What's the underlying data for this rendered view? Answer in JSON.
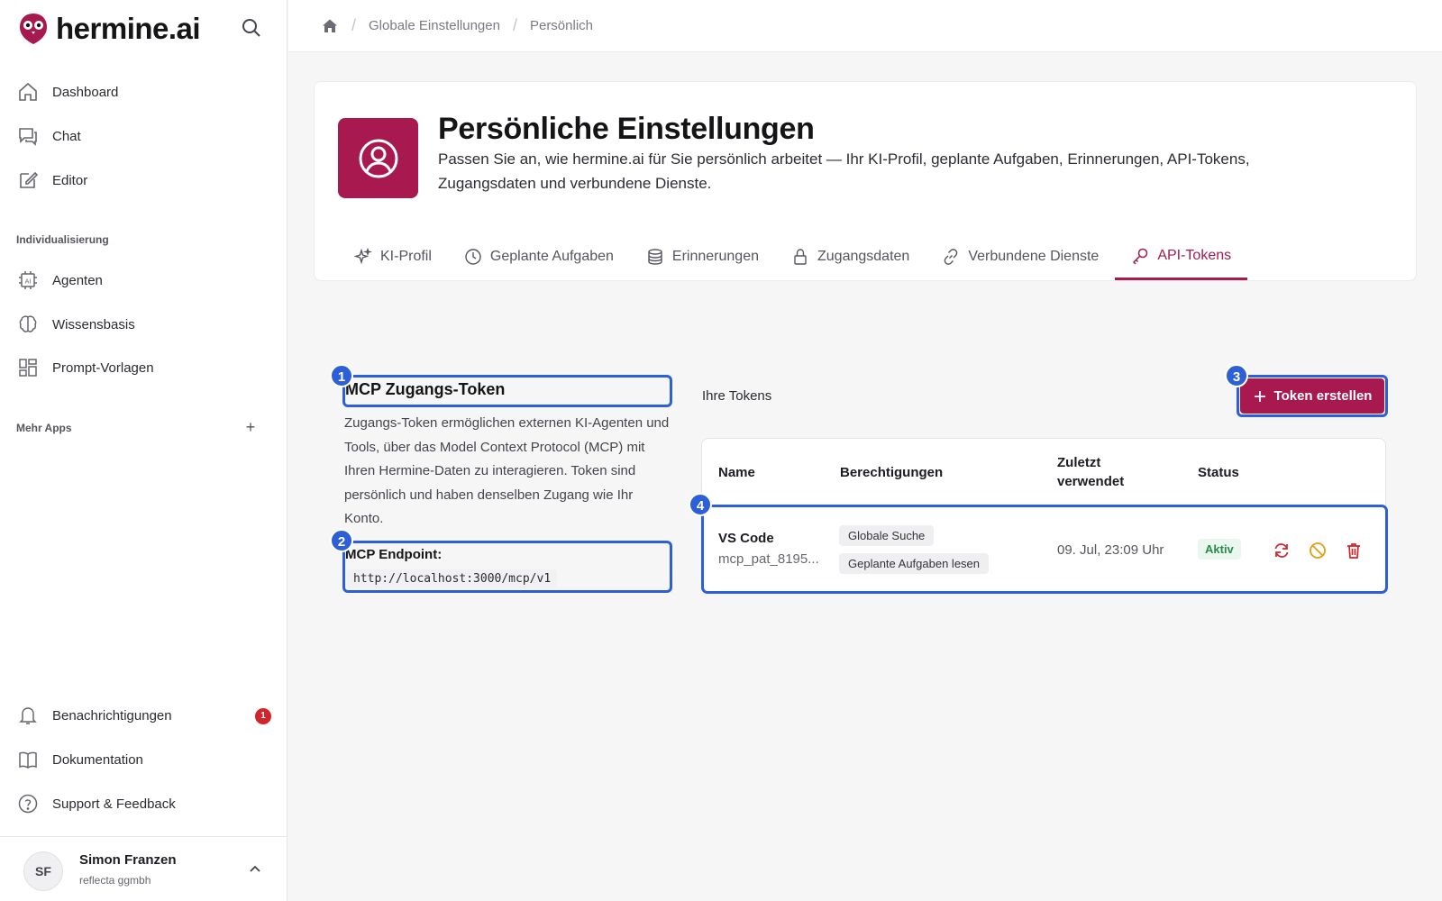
{
  "brand": {
    "name": "hermine.ai"
  },
  "sidebar": {
    "main_items": [
      {
        "label": "Dashboard",
        "icon": "home-icon"
      },
      {
        "label": "Chat",
        "icon": "chat-icon"
      },
      {
        "label": "Editor",
        "icon": "edit-icon"
      }
    ],
    "section_custom": "Individualisierung",
    "custom_items": [
      {
        "label": "Agenten",
        "icon": "agent-icon"
      },
      {
        "label": "Wissensbasis",
        "icon": "brain-icon"
      },
      {
        "label": "Prompt-Vorlagen",
        "icon": "template-icon"
      }
    ],
    "section_more": "Mehr Apps",
    "bottom_items": [
      {
        "label": "Benachrichtigungen",
        "icon": "bell-icon"
      },
      {
        "label": "Dokumentation",
        "icon": "book-icon"
      },
      {
        "label": "Support & Feedback",
        "icon": "help-icon"
      }
    ],
    "notification_count": "1",
    "user": {
      "initials": "SF",
      "name": "Simon Franzen",
      "org": "reflecta ggmbh"
    }
  },
  "breadcrumb": [
    "Globale Einstellungen",
    "Persönlich"
  ],
  "header": {
    "title": "Persönliche Einstellungen",
    "description": "Passen Sie an, wie hermine.ai für Sie persönlich arbeitet — Ihr KI-Profil, geplante Aufgaben, Erinnerungen, API-Tokens, Zugangsdaten und verbundene Dienste."
  },
  "tabs": [
    {
      "label": "KI-Profil",
      "icon": "sparkle-icon"
    },
    {
      "label": "Geplante Aufgaben",
      "icon": "clock-icon"
    },
    {
      "label": "Erinnerungen",
      "icon": "database-icon"
    },
    {
      "label": "Zugangsdaten",
      "icon": "lock-icon"
    },
    {
      "label": "Verbundene Dienste",
      "icon": "link-icon"
    },
    {
      "label": "API-Tokens",
      "icon": "key-icon",
      "active": true
    }
  ],
  "mcp": {
    "title": "MCP Zugangs-Token",
    "description": "Zugangs-Token ermöglichen externen KI-Agenten und Tools, über das Model Context Protocol (MCP) mit Ihren Hermine-Daten zu interagieren. Token sind persönlich und haben denselben Zugang wie Ihr Konto.",
    "endpoint_label": "MCP Endpoint:",
    "endpoint_url": "http://localhost:3000/mcp/v1"
  },
  "tokens": {
    "label": "Ihre Tokens",
    "create_button": "Token erstellen",
    "columns": [
      "Name",
      "Berechtigungen",
      "Zuletzt verwendet",
      "Status"
    ],
    "rows": [
      {
        "name": "VS Code",
        "token": "mcp_pat_8195...",
        "permissions": [
          "Globale Suche",
          "Geplante Aufgaben lesen"
        ],
        "last_used": "09. Jul, 23:09 Uhr",
        "status": "Aktiv"
      }
    ]
  },
  "markers": [
    "1",
    "2",
    "3",
    "4"
  ],
  "colors": {
    "accent": "#a8194f",
    "highlight": "#2d5fd6",
    "status_active": "#2a8a4a",
    "warning": "#e0a010",
    "danger": "#d1252b"
  }
}
